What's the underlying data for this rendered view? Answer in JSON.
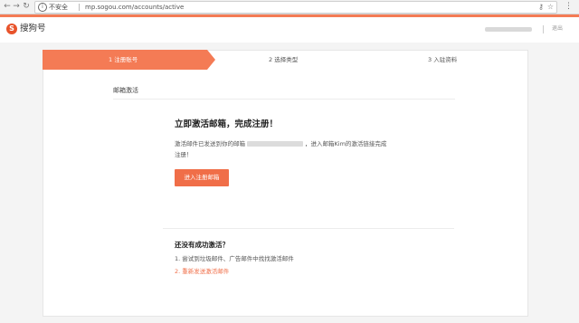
{
  "browser": {
    "security_label": "不安全",
    "url": "mp.sogou.com/accounts/active"
  },
  "header": {
    "logo_glyph": "S",
    "logo_text": "搜狗号",
    "logout": "退出"
  },
  "steps": [
    {
      "label": "1 注册账号",
      "active": true
    },
    {
      "label": "2 选择类型",
      "active": false
    },
    {
      "label": "3 入驻资料",
      "active": false
    }
  ],
  "section": {
    "title": "邮箱激活"
  },
  "activation": {
    "headline": "立即激活邮箱，完成注册！",
    "message_pre": "激活邮件已发送到你的邮箱",
    "message_post": "，进入邮箱Kim的激活链接完成",
    "message_line2": "注册！",
    "button_label": "进入注册邮箱"
  },
  "faq": {
    "title": "还没有成功激活？",
    "item1": "1. 尝试到垃圾邮件、广告邮件中找找激活邮件",
    "item2_num": "2.",
    "item2_link": "重新发送激活邮件"
  },
  "colors": {
    "accent": "#f47b55",
    "button": "#f06e48",
    "logo": "#e8532b"
  }
}
